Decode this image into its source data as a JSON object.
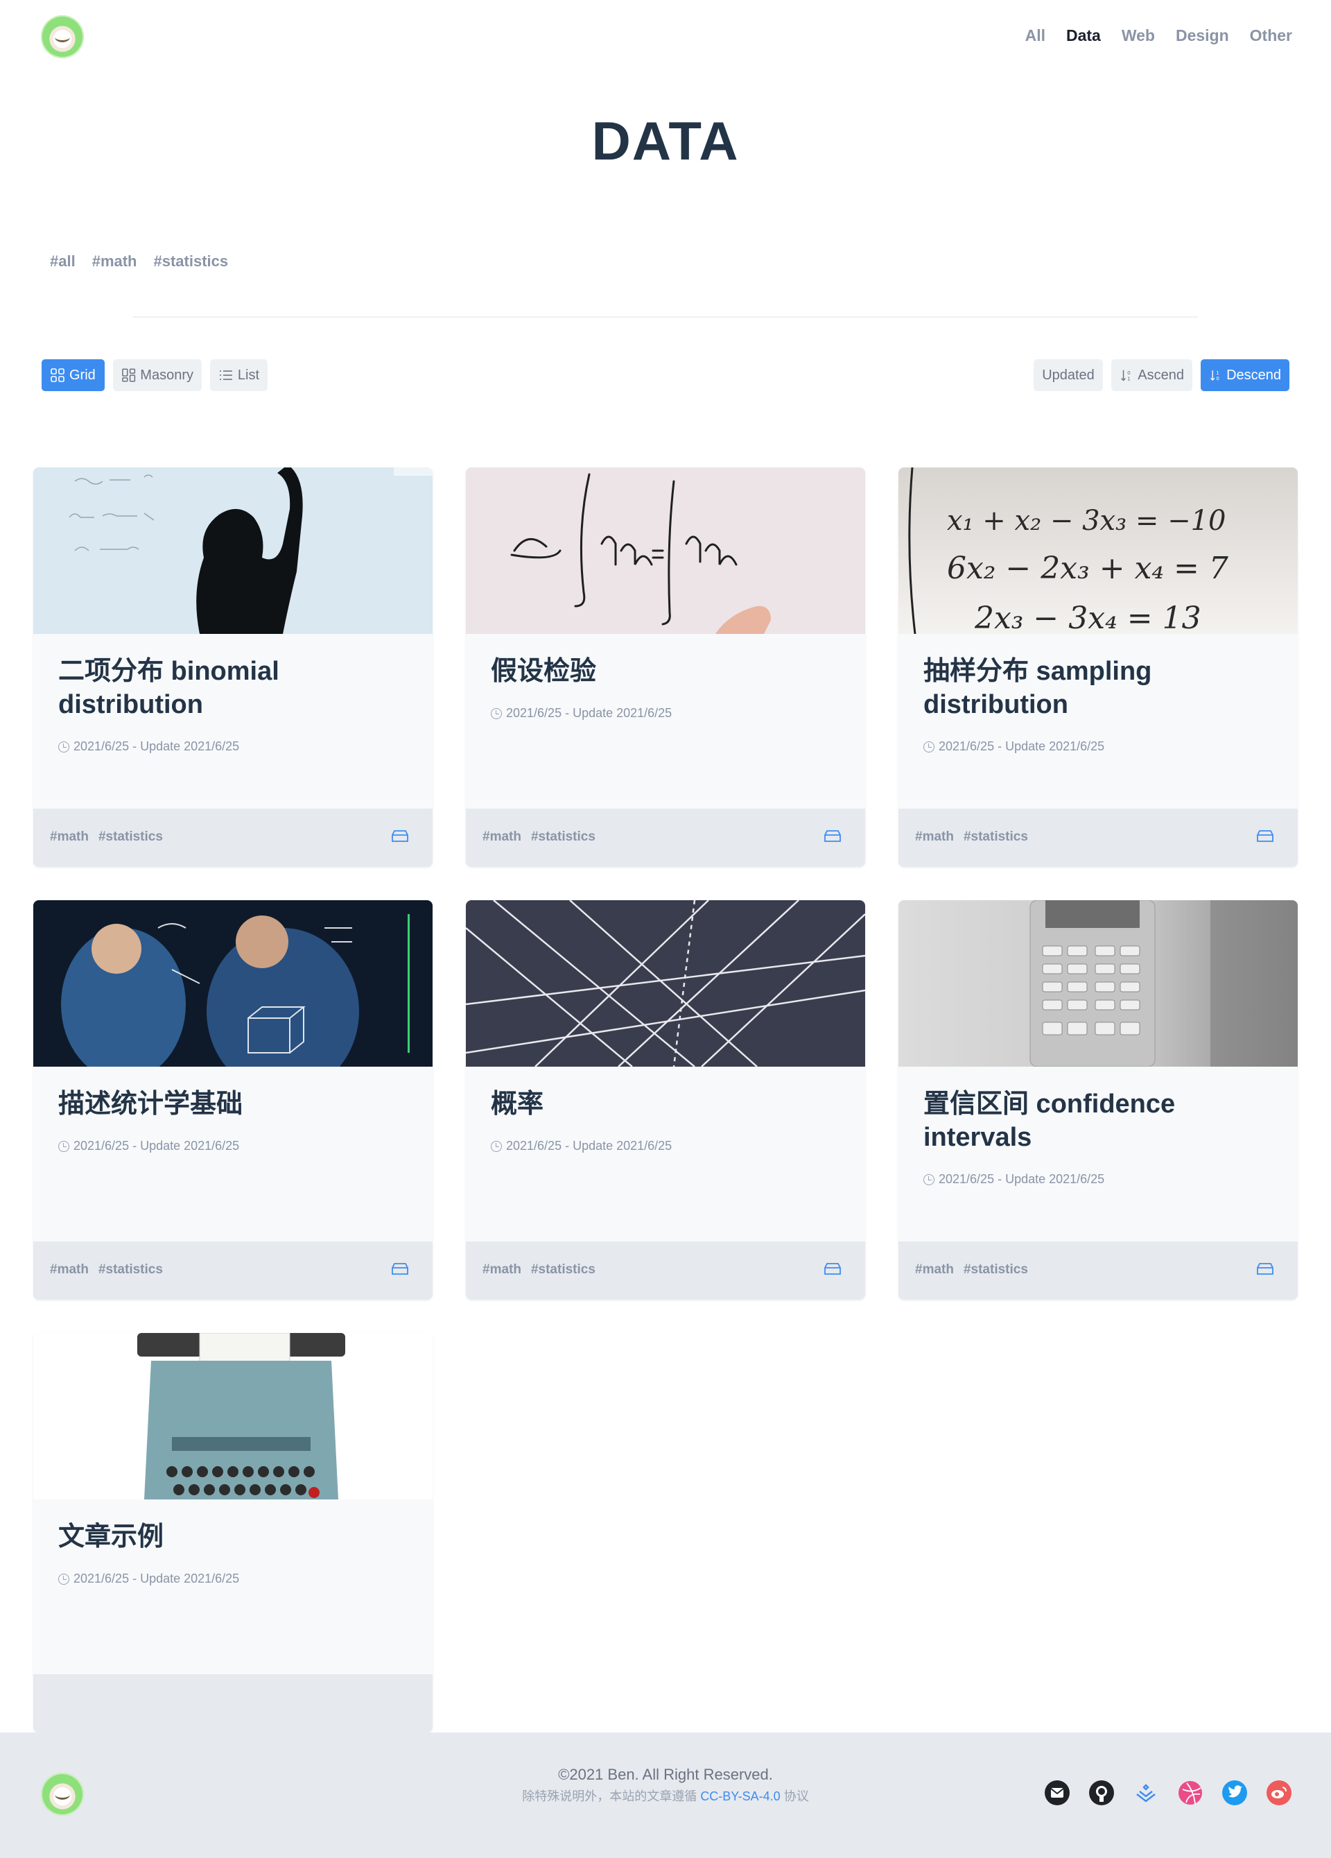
{
  "nav": {
    "items": [
      "All",
      "Data",
      "Web",
      "Design",
      "Other"
    ],
    "active": "Data"
  },
  "page": {
    "title": "DATA",
    "tags": [
      "#all",
      "#math",
      "#statistics"
    ]
  },
  "toolbar": {
    "grid": "Grid",
    "masonry": "Masonry",
    "list": "List",
    "updated": "Updated",
    "ascend": "Ascend",
    "descend": "Descend",
    "active_view": "Grid",
    "active_sort": "Descend"
  },
  "posts": [
    {
      "title": "二项分布 binomial distribution",
      "meta": "2021/6/25 - Update 2021/6/25",
      "tags": [
        "#math",
        "#statistics"
      ],
      "image": "whiteboard-math-silhouette"
    },
    {
      "title": "假设检验",
      "meta": "2021/6/25 - Update 2021/6/25",
      "tags": [
        "#math",
        "#statistics"
      ],
      "image": "whiteboard-integrals"
    },
    {
      "title": "抽样分布 sampling distribution",
      "meta": "2021/6/25 - Update 2021/6/25",
      "tags": [
        "#math",
        "#statistics"
      ],
      "image": "equation-system-print"
    },
    {
      "title": "描述统计学基础",
      "meta": "2021/6/25 - Update 2021/6/25",
      "tags": [
        "#math",
        "#statistics"
      ],
      "image": "scientists-glass-board"
    },
    {
      "title": "概率",
      "meta": "2021/6/25 - Update 2021/6/25",
      "tags": [
        "#math",
        "#statistics"
      ],
      "image": "cutting-mat-grid"
    },
    {
      "title": "置信区间 confidence intervals",
      "meta": "2021/6/25 - Update 2021/6/25",
      "tags": [
        "#math",
        "#statistics"
      ],
      "image": "calculator"
    },
    {
      "title": "文章示例",
      "meta": "2021/6/25 - Update 2021/6/25",
      "tags": [],
      "image": "typewriter"
    }
  ],
  "footer": {
    "copyright": "©2021 Ben. All Right Reserved.",
    "license_prefix": "除特殊说明外，本站的文章遵循",
    "license_link": "CC-BY-SA-4.0",
    "license_suffix": "协议",
    "social": [
      "email-icon",
      "github-icon",
      "juejin-icon",
      "dribbble-icon",
      "twitter-icon",
      "weibo-icon"
    ]
  },
  "colors": {
    "accent": "#3c8cf0",
    "title": "#243447",
    "muted": "#8a94a6",
    "card_bg": "#f7f9fb",
    "card_foot": "#e6e9ee"
  }
}
